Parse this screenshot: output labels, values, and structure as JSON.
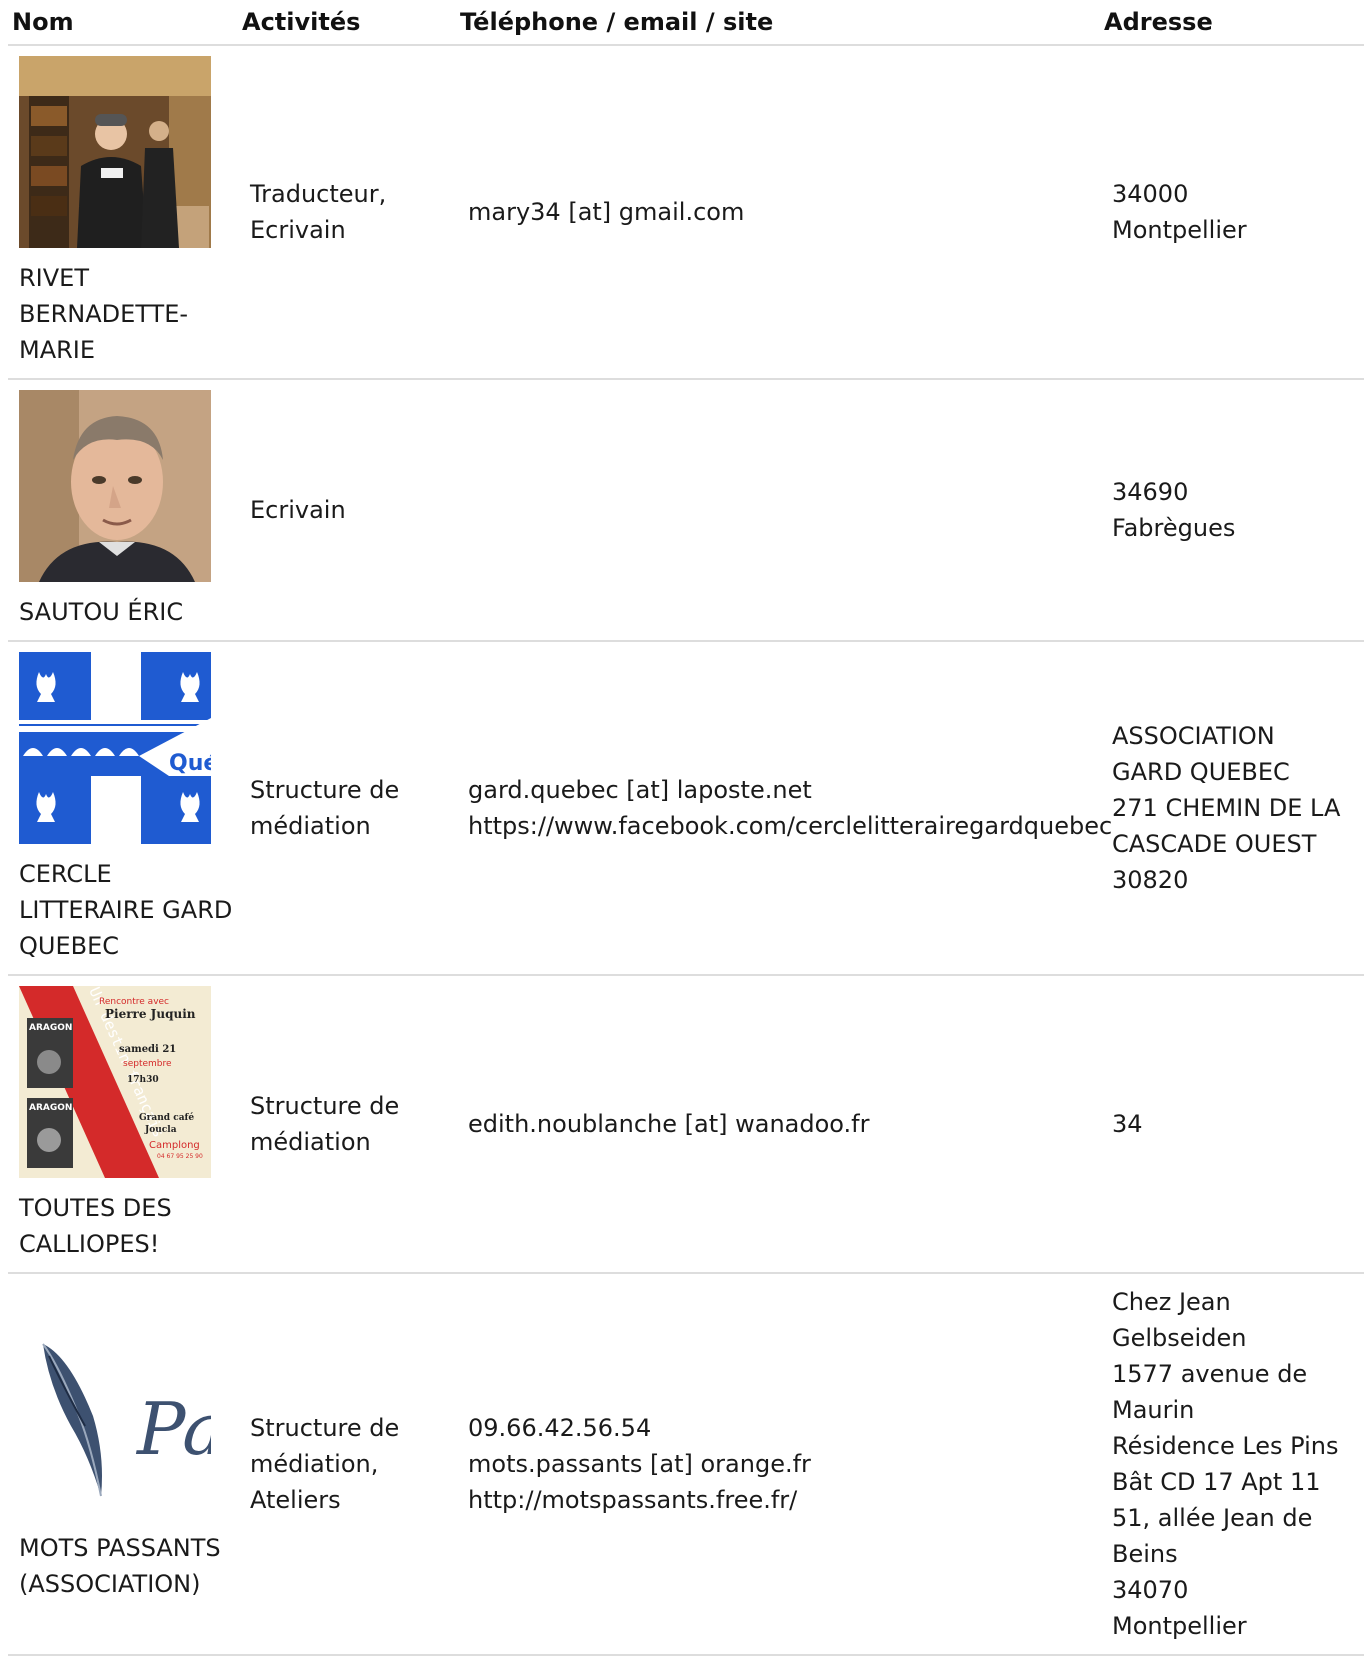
{
  "headers": {
    "nom": "Nom",
    "activites": "Activités",
    "contact": "Téléphone / email / site",
    "adresse": "Adresse"
  },
  "rows": [
    {
      "name": "RIVET BERNADETTE-MARIE",
      "photo": "portrait-library-photo",
      "activities": "Traducteur, Ecrivain",
      "contact": [
        "mary34 [at] gmail.com"
      ],
      "address": [
        "34000",
        "Montpellier"
      ]
    },
    {
      "name": "SAUTOU ÉRIC",
      "photo": "portrait-man-photo",
      "activities": "Ecrivain",
      "contact": [],
      "address": [
        "34690",
        "Fabrègues"
      ]
    },
    {
      "name": "CERCLE LITTERAIRE GARD QUEBEC",
      "photo": "quebec-flag-logo",
      "logo_text": "Qué",
      "activities": "Structure de médiation",
      "contact": [
        "gard.quebec [at] laposte.net",
        "https://www.facebook.com/cerclelitterairegardquebec"
      ],
      "address": [
        "ASSOCIATION GARD QUEBEC",
        "271 CHEMIN DE LA CASCADE OUEST",
        "30820"
      ]
    },
    {
      "name": "TOUTES DES CALLIOPES!",
      "photo": "event-poster",
      "poster": {
        "vertical": "Un destin français",
        "intro": "Rencontre avec",
        "guest": "Pierre Juquin",
        "date": "samedi 21",
        "month": "septembre",
        "time": "17h30",
        "book": "ARAGON",
        "venue1": "Grand café",
        "venue2": "Joucla",
        "town": "Camplong",
        "phone": "04 67 95 25 90"
      },
      "activities": "Structure de médiation",
      "contact": [
        "edith.noublanche [at] wanadoo.fr"
      ],
      "address": [
        "34"
      ]
    },
    {
      "name": "MOTS PASSANTS (ASSOCIATION)",
      "photo": "quill-logo",
      "logo_text": "Pa",
      "activities": "Structure de médiation, Ateliers",
      "contact": [
        "09.66.42.56.54",
        "mots.passants [at] orange.fr",
        "http://motspassants.free.fr/"
      ],
      "address": [
        "Chez Jean Gelbseiden",
        "1577 avenue de Maurin",
        "Résidence Les Pins Bât CD 17 Apt 11 51, allée Jean de Beins",
        "34070",
        "Montpellier"
      ]
    }
  ],
  "colors": {
    "quebec_blue": "#1f5bd1",
    "poster_red": "#d42a2a",
    "poster_cream": "#f3ebd3",
    "border": "#dddddd"
  }
}
